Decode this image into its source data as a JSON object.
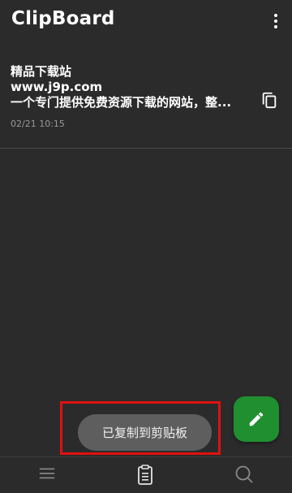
{
  "app_bar": {
    "title": "ClipBoard",
    "menu_icon": "more-vert-icon"
  },
  "clips": [
    {
      "lines": [
        "精品下载站",
        "www.j9p.com",
        "一个专门提供免费资源下载的网站，整..."
      ],
      "time": "02/21 10:15",
      "action_icon": "copy-icon"
    }
  ],
  "toast": {
    "message": "已复制到剪贴板"
  },
  "fab": {
    "icon": "edit-pencil-icon"
  },
  "bottom_nav": {
    "items": [
      {
        "icon": "menu-icon",
        "active": false
      },
      {
        "icon": "clipboard-icon",
        "active": true
      },
      {
        "icon": "search-icon",
        "active": false
      }
    ]
  },
  "colors": {
    "background": "#2b2b2b",
    "fab": "#1f8f2f",
    "toast_bg": "#5e5e5e",
    "highlight_border": "#e01010",
    "secondary_text": "#9a9a9a"
  }
}
